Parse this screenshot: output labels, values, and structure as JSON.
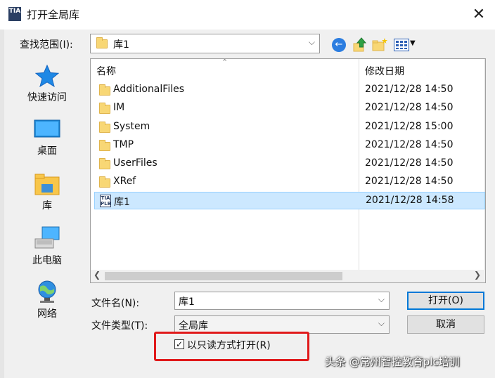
{
  "window": {
    "title": "打开全局库",
    "close_glyph": "✕",
    "app_icon_text": "TIA"
  },
  "lookin": {
    "label": "查找范围(I):",
    "value": "库1"
  },
  "toolbar_icons": [
    "back-icon",
    "up-folder-icon",
    "new-folder-icon",
    "view-menu-icon"
  ],
  "places": [
    {
      "label": "快速访问",
      "icon": "quick-access-star-icon"
    },
    {
      "label": "桌面",
      "icon": "desktop-icon"
    },
    {
      "label": "库",
      "icon": "libraries-icon"
    },
    {
      "label": "此电脑",
      "icon": "this-pc-icon"
    },
    {
      "label": "网络",
      "icon": "network-globe-icon"
    }
  ],
  "list": {
    "col_name": "名称",
    "col_date": "修改日期",
    "rows": [
      {
        "name": "AdditionalFiles",
        "date": "2021/12/28 14:50",
        "type": "folder"
      },
      {
        "name": "IM",
        "date": "2021/12/28 14:50",
        "type": "folder"
      },
      {
        "name": "System",
        "date": "2021/12/28 15:00",
        "type": "folder"
      },
      {
        "name": "TMP",
        "date": "2021/12/28 14:50",
        "type": "folder"
      },
      {
        "name": "UserFiles",
        "date": "2021/12/28 14:50",
        "type": "folder"
      },
      {
        "name": "XRef",
        "date": "2021/12/28 14:50",
        "type": "folder"
      },
      {
        "name": "库1",
        "date": "2021/12/28 14:58",
        "type": "tia-library",
        "selected": true
      }
    ]
  },
  "filename": {
    "label": "文件名(N):",
    "value": "库1"
  },
  "filetype": {
    "label": "文件类型(T):",
    "value": "全局库"
  },
  "buttons": {
    "open": "打开(O)",
    "cancel": "取消"
  },
  "readonly": {
    "label": "以只读方式打开(R)",
    "checked": true,
    "check_glyph": "✓"
  },
  "watermark": "头条 @常州智控教育plc培训",
  "colors": {
    "selection": "#cce8ff",
    "highlight_box": "#e0191a",
    "primary_border": "#0078d7"
  }
}
